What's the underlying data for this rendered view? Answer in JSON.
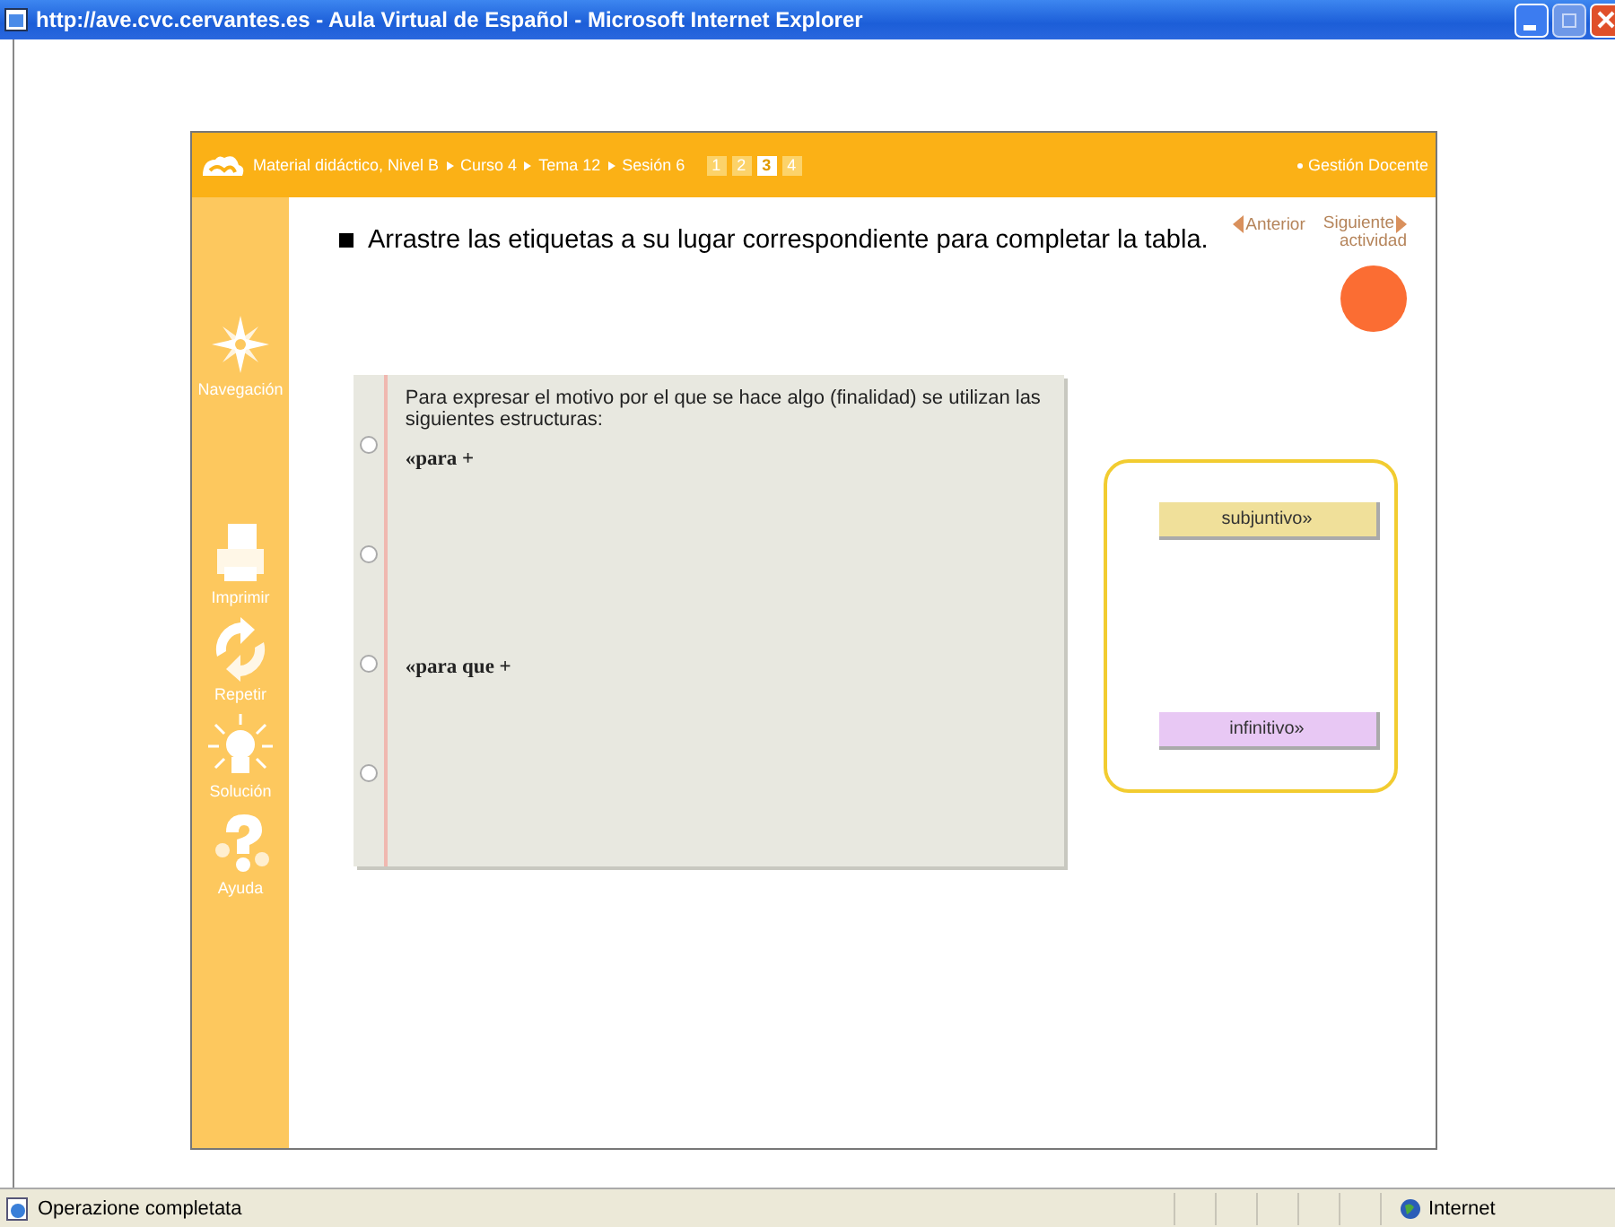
{
  "window": {
    "title": "http://ave.cvc.cervantes.es - Aula Virtual de Español - Microsoft Internet Explorer"
  },
  "header": {
    "breadcrumb": [
      "Material didáctico, Nivel B",
      "Curso 4",
      "Tema 12",
      "Sesión 6"
    ],
    "pages": [
      {
        "label": "1",
        "selected": false
      },
      {
        "label": "2",
        "selected": false
      },
      {
        "label": "3",
        "selected": true
      },
      {
        "label": "4",
        "selected": false
      }
    ],
    "link": "Gestión Docente"
  },
  "sidebar": {
    "items": [
      {
        "label": "Navegación",
        "kind": "compass"
      },
      {
        "label": "Imprimir",
        "kind": "printer"
      },
      {
        "label": "Repetir",
        "kind": "repeat"
      },
      {
        "label": "Solución",
        "kind": "bulb"
      },
      {
        "label": "Ayuda",
        "kind": "help"
      }
    ]
  },
  "instruction": "Arrastre las etiquetas a su lugar correspondiente para completar la tabla.",
  "nav": {
    "previous": "Anterior",
    "next": [
      "Siguiente",
      "actividad"
    ]
  },
  "worksheet": {
    "intro": "Para  expresar el motivo por el que se hace algo (finalidad) se utilizan las siguientes estructuras:",
    "lines": [
      "«para +",
      "«para que +"
    ]
  },
  "tags": [
    {
      "label": "subjuntivo»",
      "color": "#f0e09a"
    },
    {
      "label": "infinitivo»",
      "color": "#e8c8f4"
    }
  ],
  "status_bar": {
    "text": "Operazione completata",
    "zone": "Internet"
  }
}
